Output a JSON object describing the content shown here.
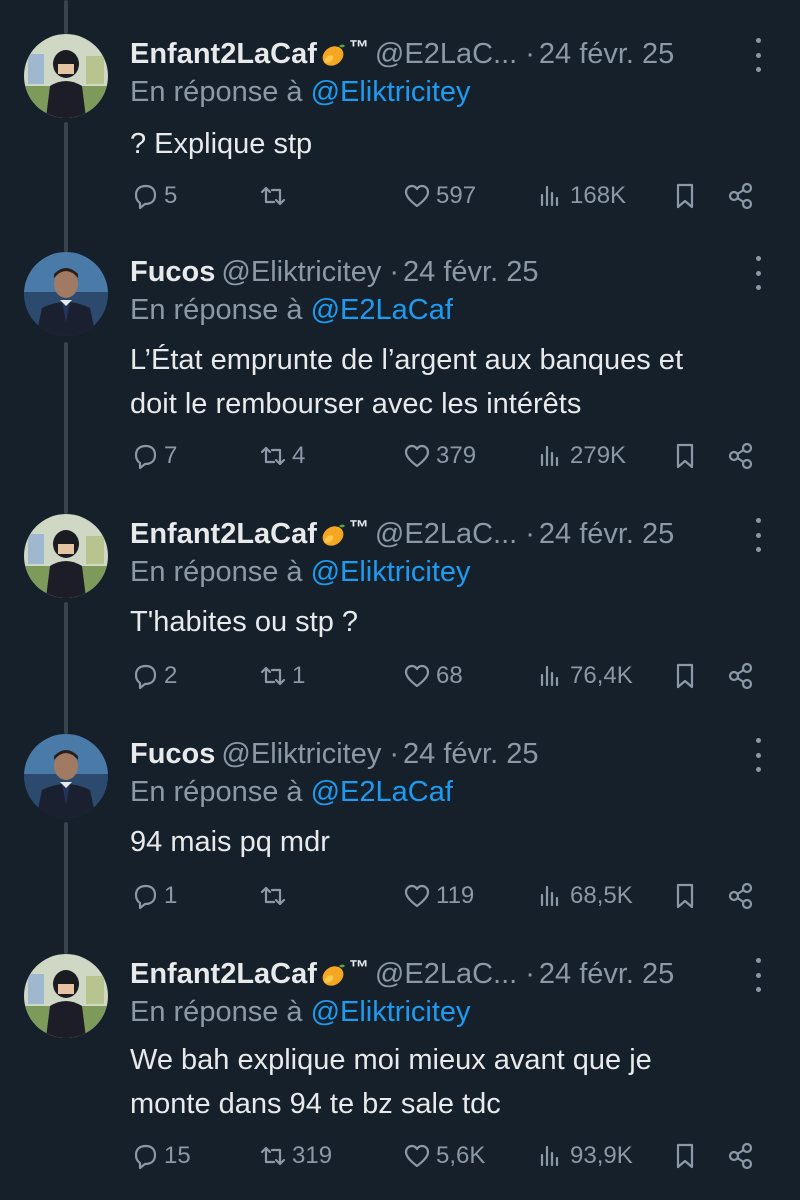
{
  "reply_prefix": "En réponse à",
  "tweets": [
    {
      "name": "Enfant2LaCaf",
      "tm": "™",
      "handle": "@E2LaC...",
      "sep": "·",
      "date": "24 févr. 25",
      "reply_to": "@Eliktricitey",
      "lines": [
        "? Explique stp"
      ],
      "stats": {
        "replies": "5",
        "retweets": "",
        "likes": "597",
        "views": "168K"
      }
    },
    {
      "name": "Fucos",
      "tm": "",
      "handle": "@Eliktricitey",
      "sep": "·",
      "date": "24 févr. 25",
      "reply_to": "@E2LaCaf",
      "lines": [
        "L’État emprunte de l’argent aux banques et",
        "doit le rembourser avec les intérêts"
      ],
      "stats": {
        "replies": "7",
        "retweets": "4",
        "likes": "379",
        "views": "279K"
      }
    },
    {
      "name": "Enfant2LaCaf",
      "tm": "™",
      "handle": "@E2LaC...",
      "sep": "·",
      "date": "24 févr. 25",
      "reply_to": "@Eliktricitey",
      "lines": [
        "T'habites ou stp ?"
      ],
      "stats": {
        "replies": "2",
        "retweets": "1",
        "likes": "68",
        "views": "76,4K"
      }
    },
    {
      "name": "Fucos",
      "tm": "",
      "handle": "@Eliktricitey",
      "sep": "·",
      "date": "24 févr. 25",
      "reply_to": "@E2LaCaf",
      "lines": [
        "94 mais pq mdr"
      ],
      "stats": {
        "replies": "1",
        "retweets": "",
        "likes": "119",
        "views": "68,5K"
      }
    },
    {
      "name": "Enfant2LaCaf",
      "tm": "™",
      "handle": "@E2LaC...",
      "sep": "·",
      "date": "24 févr. 25",
      "reply_to": "@Eliktricitey",
      "lines": [
        "We bah explique moi mieux avant que je",
        "monte dans 94 te bz sale tdc"
      ],
      "stats": {
        "replies": "15",
        "retweets": "319",
        "likes": "5,6K",
        "views": "93,9K"
      }
    }
  ],
  "colors": {
    "background": "#15202b",
    "text": "#e7e9ea",
    "muted": "#8b98a5",
    "link": "#1d9bf0",
    "thread_line": "#38444d"
  }
}
